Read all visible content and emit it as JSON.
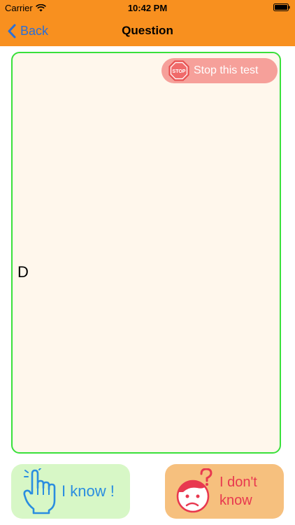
{
  "status_bar": {
    "carrier": "Carrier",
    "time": "10:42 PM"
  },
  "nav": {
    "back_label": "Back",
    "title": "Question"
  },
  "card": {
    "stop_label": "Stop this test",
    "stop_sign_text": "STOP",
    "question_text": "D"
  },
  "actions": {
    "know_label": "I know !",
    "dont_know_label": "I don't know"
  },
  "colors": {
    "nav_background": "#f8901f",
    "card_border": "#39e03a",
    "card_background": "#fff7ec",
    "stop_button": "#f6a09a",
    "know_button": "#d7f7c6",
    "know_text": "#2a8de0",
    "dont_know_button": "#f6c07e",
    "dont_know_text": "#e8384f"
  },
  "icons": {
    "wifi": "wifi-icon",
    "battery": "battery-icon",
    "back": "chevron-left-icon",
    "stop": "stop-sign-icon",
    "know": "pointing-hand-icon",
    "dont_know": "confused-face-icon"
  }
}
